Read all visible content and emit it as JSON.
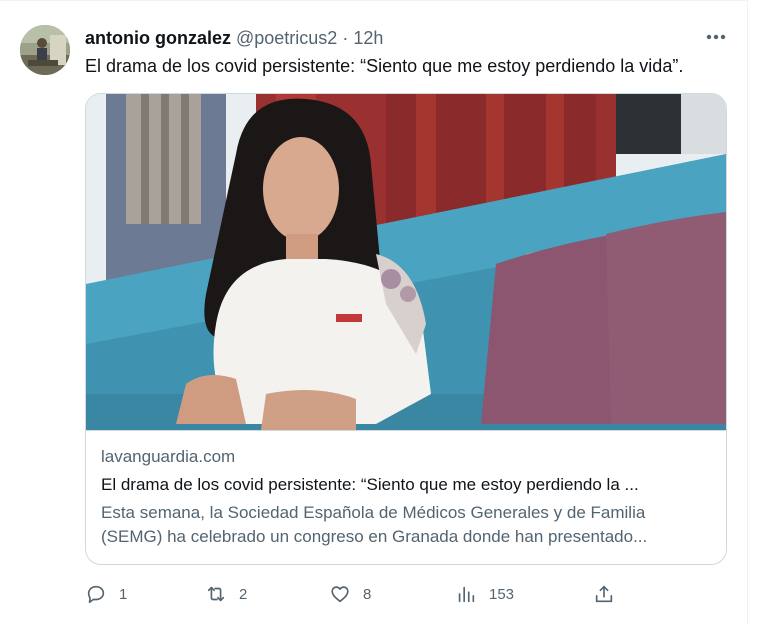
{
  "tweet": {
    "display_name": "antonio gonzalez",
    "handle": "@poetricus2",
    "separator": "·",
    "time": "12h",
    "text": "El drama de los covid persistente: “Siento que me estoy perdiendo la vida”.",
    "more_icon": "more-horizontal-icon"
  },
  "card": {
    "domain": "lavanguardia.com",
    "title": "El drama de los covid persistente: “Siento que me estoy perdiendo la ...",
    "description_line1": "Esta semana, la Sociedad Española de Médicos Generales y de Familia",
    "description_line2": "(SEMG) ha celebrado un congreso en Granada donde han presentado..."
  },
  "actions": {
    "replies": "1",
    "retweets": "2",
    "likes": "8",
    "views": "153"
  },
  "colors": {
    "text_primary": "#0f1419",
    "text_secondary": "#536471",
    "border": "#cfd9de"
  }
}
